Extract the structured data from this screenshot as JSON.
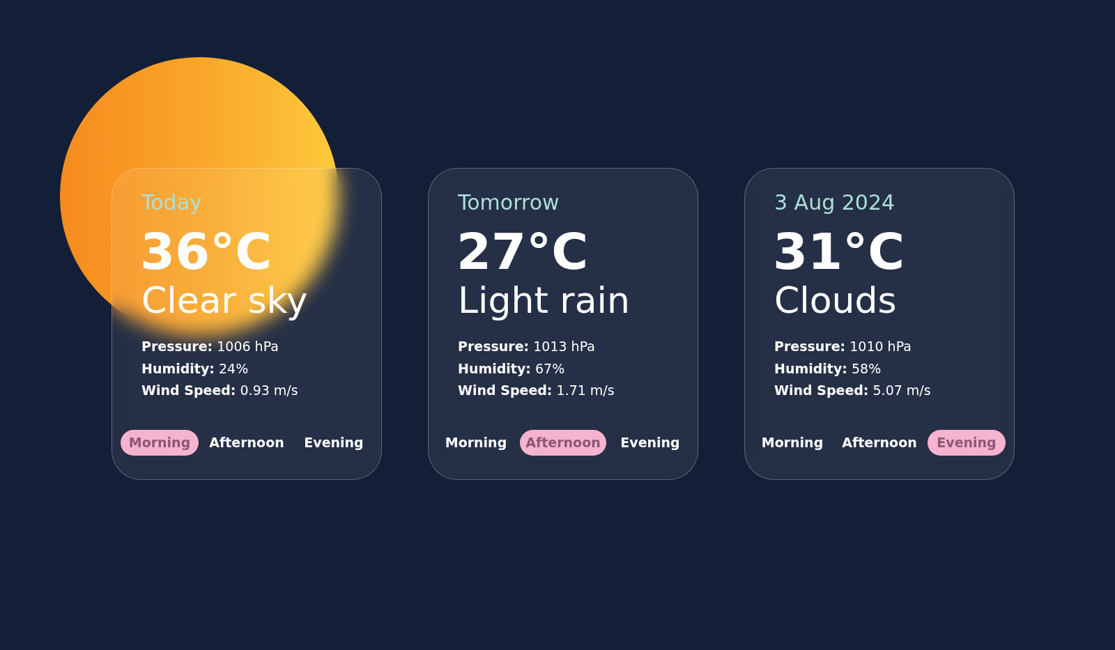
{
  "cards": [
    {
      "day": "Today",
      "temperature": "36°C",
      "condition": "Clear sky",
      "stats": [
        {
          "label": "Pressure:",
          "value": "1006 hPa"
        },
        {
          "label": "Humidity:",
          "value": "24%"
        },
        {
          "label": "Wind Speed:",
          "value": "0.93 m/s"
        }
      ],
      "periods": [
        {
          "label": "Morning",
          "selected": true
        },
        {
          "label": "Afternoon",
          "selected": false
        },
        {
          "label": "Evening",
          "selected": false
        }
      ]
    },
    {
      "day": "Tomorrow",
      "temperature": "27°C",
      "condition": "Light rain",
      "stats": [
        {
          "label": "Pressure:",
          "value": "1013 hPa"
        },
        {
          "label": "Humidity:",
          "value": "67%"
        },
        {
          "label": "Wind Speed:",
          "value": "1.71 m/s"
        }
      ],
      "periods": [
        {
          "label": "Morning",
          "selected": false
        },
        {
          "label": "Afternoon",
          "selected": true
        },
        {
          "label": "Evening",
          "selected": false
        }
      ]
    },
    {
      "day": "3 Aug 2024",
      "temperature": "31°C",
      "condition": "Clouds",
      "stats": [
        {
          "label": "Pressure:",
          "value": "1010 hPa"
        },
        {
          "label": "Humidity:",
          "value": "58%"
        },
        {
          "label": "Wind Speed:",
          "value": "5.07 m/s"
        }
      ],
      "periods": [
        {
          "label": "Morning",
          "selected": false
        },
        {
          "label": "Afternoon",
          "selected": false
        },
        {
          "label": "Evening",
          "selected": true
        }
      ]
    }
  ]
}
